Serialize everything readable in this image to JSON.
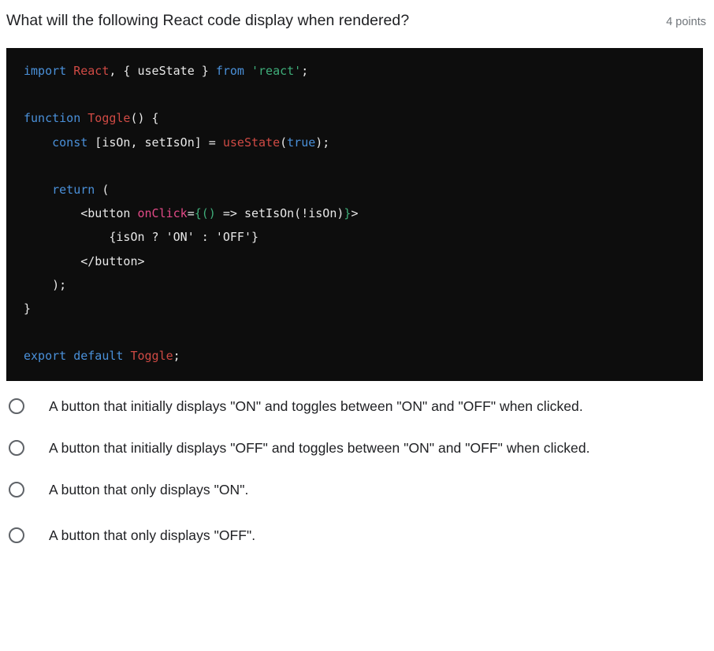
{
  "question": {
    "title": "What will the following React code display when rendered?",
    "points_label": "4 points"
  },
  "code_block": {
    "language": "jsx",
    "background_color": "#0d0d0d",
    "colors": {
      "keyword": "#4a90d9",
      "identifier": "#cf4a44",
      "string": "#3fae7a",
      "attribute": "#e24a87",
      "brace": "#3fae7a",
      "plain": "#e8e8e8"
    },
    "lines": [
      {
        "tokens": [
          {
            "t": "import",
            "c": "kw"
          },
          {
            "t": " ",
            "c": "plain"
          },
          {
            "t": "React",
            "c": "ident"
          },
          {
            "t": ", { useState } ",
            "c": "plain"
          },
          {
            "t": "from",
            "c": "kw"
          },
          {
            "t": " ",
            "c": "plain"
          },
          {
            "t": "'react'",
            "c": "str"
          },
          {
            "t": ";",
            "c": "plain"
          }
        ]
      },
      {
        "tokens": []
      },
      {
        "tokens": [
          {
            "t": "function",
            "c": "kw"
          },
          {
            "t": " ",
            "c": "plain"
          },
          {
            "t": "Toggle",
            "c": "ident"
          },
          {
            "t": "() {",
            "c": "plain"
          }
        ]
      },
      {
        "tokens": [
          {
            "t": "    ",
            "c": "plain"
          },
          {
            "t": "const",
            "c": "kw"
          },
          {
            "t": " [isOn, setIsOn] = ",
            "c": "plain"
          },
          {
            "t": "useState",
            "c": "ident"
          },
          {
            "t": "(",
            "c": "plain"
          },
          {
            "t": "true",
            "c": "kw"
          },
          {
            "t": ");",
            "c": "plain"
          }
        ]
      },
      {
        "tokens": []
      },
      {
        "tokens": [
          {
            "t": "    ",
            "c": "plain"
          },
          {
            "t": "return",
            "c": "kw"
          },
          {
            "t": " (",
            "c": "plain"
          }
        ]
      },
      {
        "tokens": [
          {
            "t": "        <button ",
            "c": "plain"
          },
          {
            "t": "onClick",
            "c": "attr"
          },
          {
            "t": "=",
            "c": "plain"
          },
          {
            "t": "{()",
            "c": "brace"
          },
          {
            "t": " => setIsOn(!isOn)",
            "c": "plain"
          },
          {
            "t": "}",
            "c": "brace"
          },
          {
            "t": ">",
            "c": "plain"
          }
        ]
      },
      {
        "tokens": [
          {
            "t": "            {isOn ? 'ON' : 'OFF'}",
            "c": "plain"
          }
        ]
      },
      {
        "tokens": [
          {
            "t": "        </button>",
            "c": "plain"
          }
        ]
      },
      {
        "tokens": [
          {
            "t": "    );",
            "c": "plain"
          }
        ]
      },
      {
        "tokens": [
          {
            "t": "}",
            "c": "plain"
          }
        ]
      },
      {
        "tokens": []
      },
      {
        "tokens": [
          {
            "t": "export",
            "c": "kw"
          },
          {
            "t": " ",
            "c": "plain"
          },
          {
            "t": "default",
            "c": "kw"
          },
          {
            "t": " ",
            "c": "plain"
          },
          {
            "t": "Toggle",
            "c": "ident"
          },
          {
            "t": ";",
            "c": "plain"
          }
        ]
      }
    ]
  },
  "options": [
    {
      "label": "A button that initially displays \"ON\" and toggles between \"ON\" and \"OFF\" when clicked.",
      "selected": false,
      "multiline": true
    },
    {
      "label": "A button that initially displays \"OFF\" and toggles between \"ON\" and \"OFF\" when clicked.",
      "selected": false,
      "multiline": true
    },
    {
      "label": "A button that only displays \"ON\".",
      "selected": false,
      "multiline": false
    },
    {
      "label": "A button that only displays \"OFF\".",
      "selected": false,
      "multiline": false
    }
  ]
}
